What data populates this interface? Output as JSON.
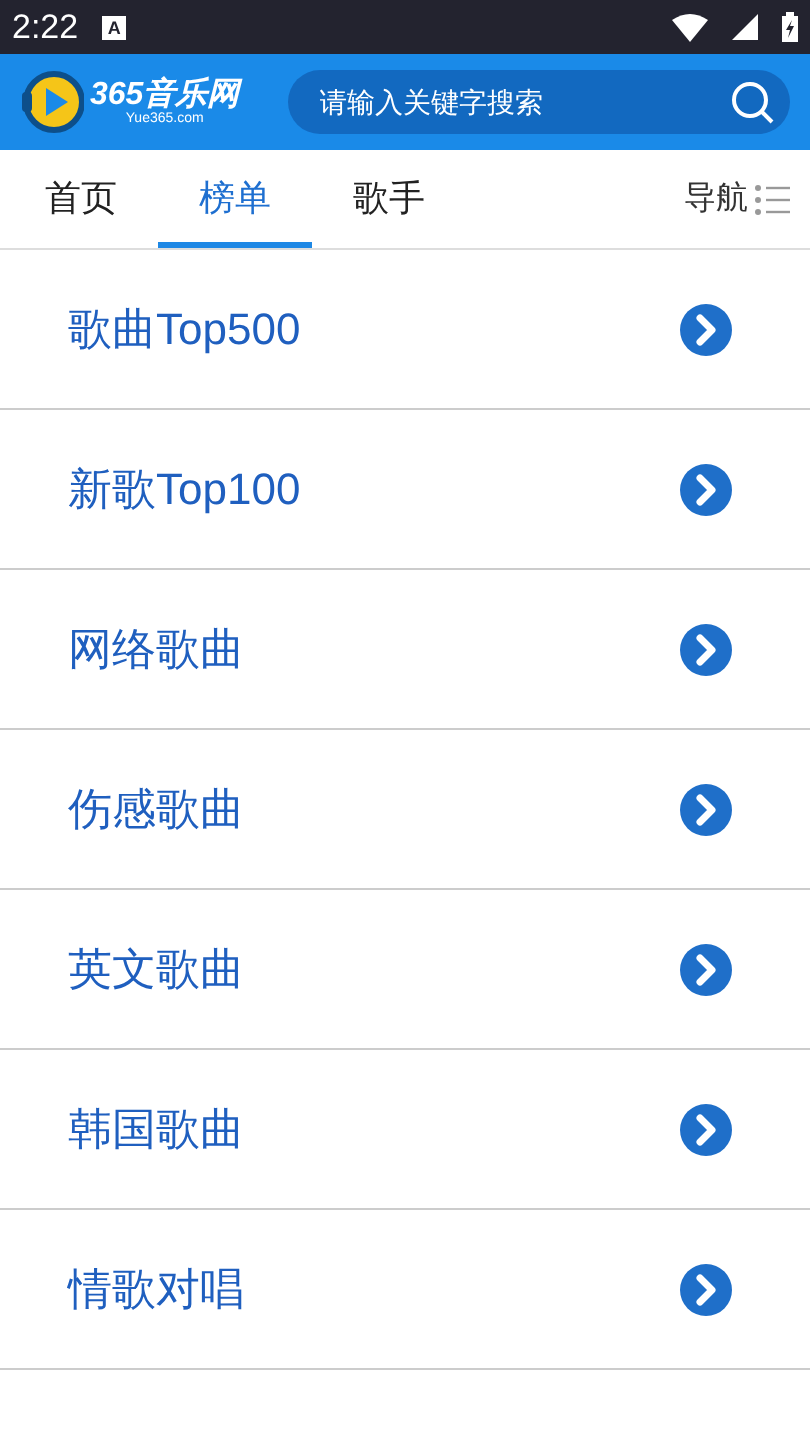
{
  "status_bar": {
    "time": "2:22",
    "notification": "A"
  },
  "header": {
    "logo_title": "365音乐网",
    "logo_subtitle": "Yue365.com",
    "search": {
      "placeholder": "请输入关键字搜索"
    }
  },
  "tabs": [
    {
      "label": "首页",
      "selected": false
    },
    {
      "label": "榜单",
      "selected": true
    },
    {
      "label": "歌手",
      "selected": false
    }
  ],
  "nav": {
    "label": "导航"
  },
  "list": [
    {
      "label": "歌曲Top500"
    },
    {
      "label": "新歌Top100"
    },
    {
      "label": "网络歌曲"
    },
    {
      "label": "伤感歌曲"
    },
    {
      "label": "英文歌曲"
    },
    {
      "label": "韩国歌曲"
    },
    {
      "label": "情歌对唱"
    }
  ]
}
